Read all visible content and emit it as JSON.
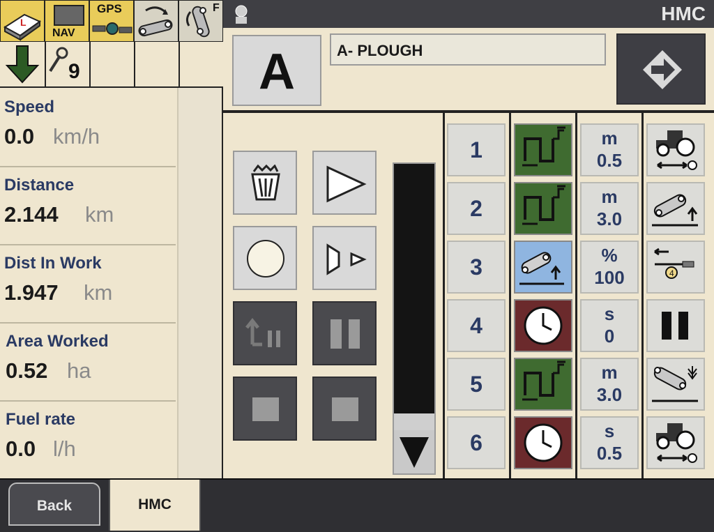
{
  "header": {
    "title": "HMC"
  },
  "status_bar": {
    "nav_label": "NAV",
    "gps_label": "GPS",
    "wrench_count": "9",
    "f_label": "F"
  },
  "sequence": {
    "letter": "A",
    "name": "A- PLOUGH"
  },
  "readouts": [
    {
      "label": "Speed",
      "value": "0.0",
      "unit": "km/h"
    },
    {
      "label": "Distance",
      "value": "2.144",
      "unit": "km"
    },
    {
      "label": "Dist In Work",
      "value": "1.947",
      "unit": "km"
    },
    {
      "label": "Area Worked",
      "value": "0.52",
      "unit": "ha"
    },
    {
      "label": "Fuel rate",
      "value": "0.0",
      "unit": "l/h"
    }
  ],
  "steps": [
    {
      "number": "1",
      "status": "headland-turn",
      "status_color": "#3f6b30",
      "unit": "m",
      "value": "0.5",
      "action": "tractor-distance-icon"
    },
    {
      "number": "2",
      "status": "headland-turn",
      "status_color": "#3f6b30",
      "unit": "m",
      "value": "3.0",
      "action": "implement-raise-icon"
    },
    {
      "number": "3",
      "status": "implement-raise",
      "status_color": "#8fb5e0",
      "unit": "%",
      "value": "100",
      "action": "hitch-position-icon"
    },
    {
      "number": "4",
      "status": "timer",
      "status_color": "#6b2a2c",
      "unit": "s",
      "value": "0",
      "action": "pause-icon"
    },
    {
      "number": "5",
      "status": "headland-turn",
      "status_color": "#3f6b30",
      "unit": "m",
      "value": "3.0",
      "action": "implement-lower-icon"
    },
    {
      "number": "6",
      "status": "timer",
      "status_color": "#6b2a2c",
      "unit": "s",
      "value": "0.5",
      "action": "tractor-distance-icon"
    }
  ],
  "tabs": {
    "back_label": "Back",
    "active_label": "HMC"
  },
  "colors": {
    "cream": "#efe6cf",
    "dark": "#3a3a3e",
    "green": "#3f6b30",
    "maroon": "#6b2a2c",
    "blue": "#8fb5e0",
    "text_blue": "#2a3a63"
  }
}
